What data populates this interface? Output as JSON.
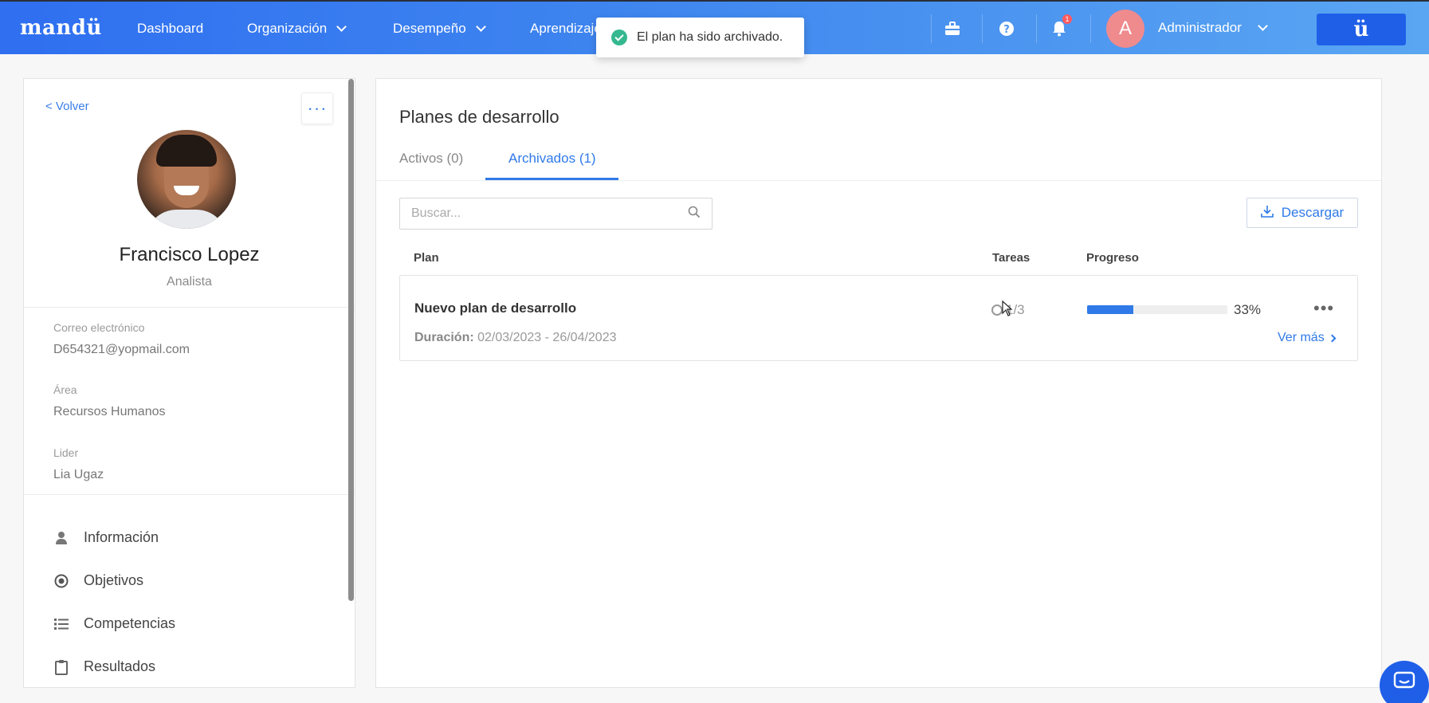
{
  "navbar": {
    "logo": "mandü",
    "items": [
      {
        "label": "Dashboard",
        "has_dropdown": false
      },
      {
        "label": "Organización",
        "has_dropdown": true
      },
      {
        "label": "Desempeño",
        "has_dropdown": true
      },
      {
        "label": "Aprendizaje",
        "has_dropdown": true
      }
    ],
    "notification_count": "1",
    "avatar_initial": "A",
    "user_name": "Administrador",
    "brand_button": "ü"
  },
  "toast": {
    "message": "El plan ha sido archivado."
  },
  "profile": {
    "back_label": "< Volver",
    "more_label": "···",
    "name": "Francisco Lopez",
    "role": "Analista",
    "fields": [
      {
        "label": "Correo electrónico",
        "value": "D654321@yopmail.com"
      },
      {
        "label": "Área",
        "value": "Recursos Humanos"
      },
      {
        "label": "Lider",
        "value": "Lia Ugaz"
      }
    ],
    "menu": [
      {
        "label": "Información",
        "icon": "user-icon"
      },
      {
        "label": "Objetivos",
        "icon": "target-icon"
      },
      {
        "label": "Competencias",
        "icon": "list-icon"
      },
      {
        "label": "Resultados",
        "icon": "clipboard-icon"
      }
    ]
  },
  "main": {
    "title": "Planes de desarrollo",
    "tabs": [
      {
        "label": "Activos (0)",
        "active": false
      },
      {
        "label": "Archivados (1)",
        "active": true
      }
    ],
    "search_placeholder": "Buscar...",
    "download_label": "Descargar",
    "columns": {
      "plan": "Plan",
      "tasks": "Tareas",
      "progress": "Progreso"
    },
    "rows": [
      {
        "name": "Nuevo plan de desarrollo",
        "duration_label": "Duración:",
        "duration_value": "02/03/2023 - 26/04/2023",
        "tasks": "1/3",
        "progress_pct": 33,
        "progress_label": "33%",
        "more_label": "•••",
        "see_more": "Ver más"
      }
    ]
  },
  "colors": {
    "accent": "#2f7ae8",
    "brand": "#1f5fe8",
    "success": "#35b88f",
    "badge": "#ff5a5f"
  }
}
